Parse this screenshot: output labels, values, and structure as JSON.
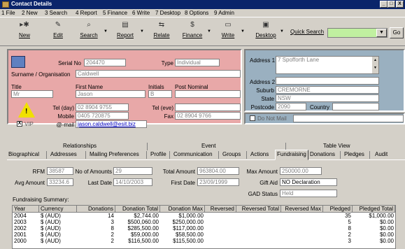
{
  "window": {
    "title": "Contact Details",
    "min": "_",
    "max": "□",
    "close": "X"
  },
  "menu": [
    "1 File",
    "2 New",
    "3 Search",
    "4 Report",
    "5 Finance",
    "6 Write",
    "7 Desktop",
    "8 Options",
    "9 Admin"
  ],
  "toolbar": {
    "new": "New",
    "edit": "Edit",
    "search": "Search",
    "report": "Report",
    "relate": "Relate",
    "finance": "Finance",
    "write": "Write",
    "desktop": "Desktop",
    "quick_search_label": "Quick Search",
    "quick_search_value": "",
    "go": "Go"
  },
  "contact": {
    "serial_label": "Serial No",
    "serial": "204470",
    "type_label": "Type",
    "type": "Individual",
    "surname_label": "Surname / Organisation",
    "surname": "Caldwell",
    "title_label": "Title",
    "title": "Mr",
    "first_name_label": "First Name",
    "first_name": "Jason",
    "initials_label": "Initials",
    "initials": "B",
    "post_nominal_label": "Post Nominal",
    "post_nominal": "",
    "tel_day_label": "Tel (day)",
    "tel_day": "02 8904 9755",
    "tel_eve_label": "Tel (eve)",
    "tel_eve": "",
    "mobile_label": "Mobile",
    "mobile": "0405 720875",
    "fax_label": "Fax",
    "fax": "02 8904 9766",
    "vip_label": "VIP",
    "vip_check": "X",
    "email_label": "@-mail",
    "email": "jason.caldwell@esit.biz"
  },
  "address": {
    "address1_label": "Address 1",
    "address1": "7 Spofforth Lane",
    "address2_label": "Address 2",
    "address2": "",
    "suburb_label": "Suburb",
    "suburb": "CREMORNE",
    "state_label": "State",
    "state": "NSW",
    "postcode_label": "Postcode",
    "postcode": "2090",
    "country_label": "Country",
    "country": "",
    "do_not_mail": "Do Not Mail"
  },
  "tab_groups": [
    "Relationships",
    "Event",
    "Table View"
  ],
  "tabs": [
    "Biographical",
    "Addresses",
    "Mailing Preferences",
    "Profile",
    "Communication",
    "Groups",
    "Actions",
    "Fundraising",
    "Donations",
    "Pledges",
    "Audit"
  ],
  "active_tab": "Fundraising",
  "fundraising": {
    "rfm_label": "RFM",
    "rfm": "38587",
    "no_amounts_label": "No of Amounts",
    "no_amounts": "29",
    "total_amount_label": "Total Amount",
    "total_amount": "963804.00",
    "max_amount_label": "Max Amount",
    "max_amount": "250000.00",
    "avg_amount_label": "Avg Amount",
    "avg_amount": "33234.6",
    "last_date_label": "Last Date",
    "last_date": "14/10/2003",
    "first_date_label": "First Date",
    "first_date": "23/09/1999",
    "gift_aid_label": "Gift Aid",
    "gift_aid": "NO Declaration",
    "gad_status_label": "GAD Status",
    "gad_status": "Held",
    "summary_label": "Fundraising Summary:"
  },
  "summary_table": {
    "columns": [
      "Year",
      "Currency",
      "Donations",
      "Donation Total",
      "Donation Max",
      "Reversed",
      "Reversed Total",
      "Reversed Max",
      "Pledged",
      "Pledged Total"
    ],
    "rows": [
      [
        "2004",
        "$ (AUD)",
        "14",
        "$2,744.00",
        "$1,000.00",
        "",
        "",
        "",
        "35",
        "$1,000.00"
      ],
      [
        "2003",
        "$ (AUD)",
        "3",
        "$500,060.00",
        "$250,000.00",
        "",
        "",
        "",
        "5",
        "$0.00"
      ],
      [
        "2002",
        "$ (AUD)",
        "8",
        "$285,500.00",
        "$117,000.00",
        "",
        "",
        "",
        "8",
        "$0.00"
      ],
      [
        "2001",
        "$ (AUD)",
        "2",
        "$59,000.00",
        "$58,500.00",
        "",
        "",
        "",
        "2",
        "$0.00"
      ],
      [
        "2000",
        "$ (AUD)",
        "2",
        "$116,500.00",
        "$115,500.00",
        "",
        "",
        "",
        "3",
        "$0.00"
      ]
    ]
  }
}
